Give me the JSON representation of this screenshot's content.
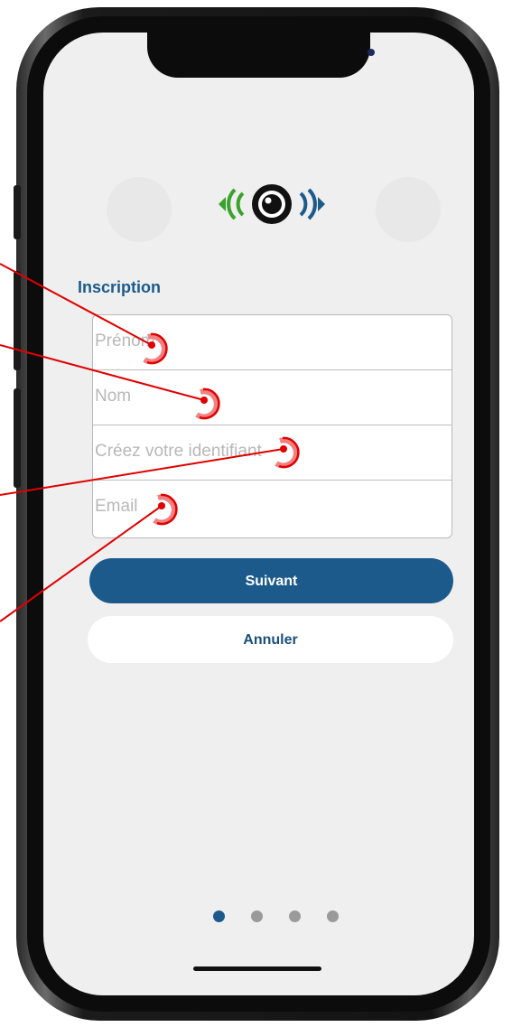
{
  "screen": {
    "title": "Inscription",
    "fields": [
      {
        "placeholder": "Prénom"
      },
      {
        "placeholder": "Nom"
      },
      {
        "placeholder": "Créez votre identifiant"
      },
      {
        "placeholder": "Email"
      }
    ],
    "next_label": "Suivant",
    "cancel_label": "Annuler",
    "pager": {
      "pages": 4,
      "current": 1
    }
  },
  "colors": {
    "accent": "#1c5a8c",
    "logo_green": "#3aa22d",
    "logo_blue": "#1c5a8c",
    "annotation": "#e00000"
  },
  "icons": [
    "app-logo-eye-icon"
  ]
}
